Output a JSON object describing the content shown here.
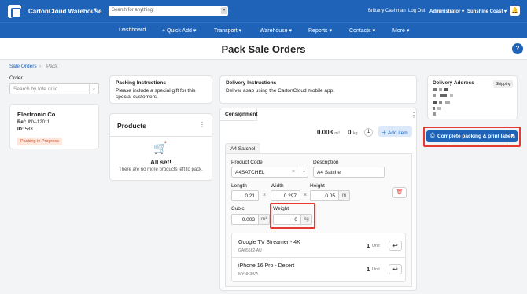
{
  "topbar": {
    "brand": "CartonCloud Warehouse",
    "search_placeholder": "Search for anything!",
    "user": "Brittany Cashman",
    "logout": "Log Out",
    "role": "Administrator",
    "location": "Sunshine Coast"
  },
  "nav": {
    "dashboard": "Dashboard",
    "quick_add": "+ Quick Add",
    "transport": "Transport",
    "warehouse": "Warehouse",
    "reports": "Reports",
    "contacts": "Contacts",
    "more": "More"
  },
  "page": {
    "title": "Pack Sale Orders",
    "breadcrumb_parent": "Sale Orders",
    "breadcrumb_current": "Pack"
  },
  "order": {
    "label": "Order",
    "search_placeholder": "Search by tote or id...",
    "customer": "Electronic Co",
    "ref_label": "Ref:",
    "ref": "INV-12011",
    "id_label": "ID:",
    "id": "583",
    "status": "Packing in Progress"
  },
  "instructions": {
    "packing_title": "Packing Instructions",
    "packing_text": "Please include a special gift for this special customers.",
    "delivery_title": "Delivery Instructions",
    "delivery_text": "Deliver asap using the CartonCloud mobile app."
  },
  "products": {
    "title": "Products",
    "empty_title": "All set!",
    "empty_text": "There are no more products left to pack."
  },
  "consignment": {
    "tab": "Consignment",
    "cubic_total": "0.003",
    "cubic_unit": "m³",
    "weight_total": "0",
    "weight_unit": "kg",
    "count": "1",
    "add_item": "Add item",
    "package_tab": "A4 Satchel",
    "product_code_label": "Product Code",
    "product_code": "A4SATCHEL",
    "description_label": "Description",
    "description": "A4 Satchel",
    "length_label": "Length",
    "length": "0.21",
    "width_label": "Width",
    "width": "0.297",
    "height_label": "Height",
    "height": "0.05",
    "dim_unit": "m",
    "cubic_label": "Cubic",
    "cubic": "0.003",
    "weight_label": "Weight",
    "weight": "0",
    "items": [
      {
        "name": "Google TV Streamer - 4K",
        "sku": "GA05682-AU",
        "qty": "1",
        "unit": "Unit"
      },
      {
        "name": "iPhone 16 Pro - Desert",
        "sku": "MYNK3X/A",
        "qty": "1",
        "unit": "Unit"
      }
    ]
  },
  "delivery": {
    "title": "Delivery Address",
    "badge": "Shipping"
  },
  "actions": {
    "complete": "Complete packing & print labels"
  },
  "colors": {
    "primary": "#1e63b8",
    "highlight": "#e53935",
    "status_bg": "#fde7dd",
    "status_text": "#d4502a"
  }
}
